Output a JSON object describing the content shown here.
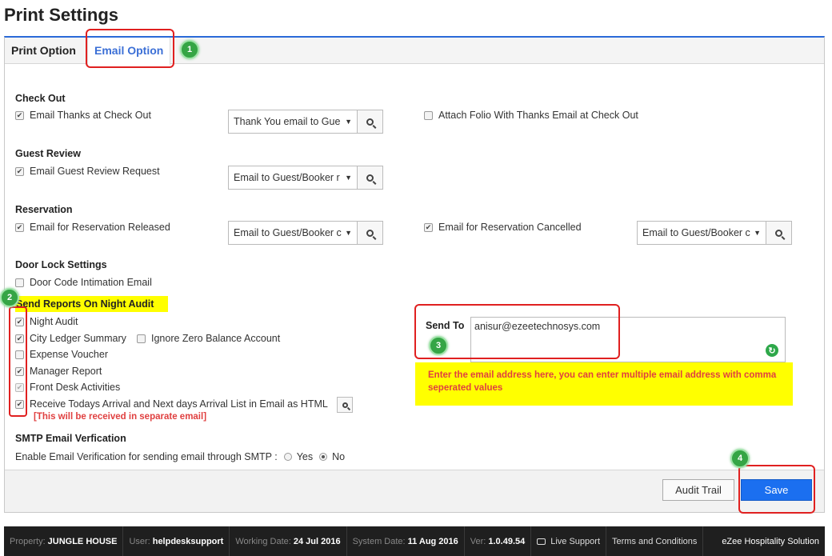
{
  "page_title": "Print Settings",
  "tabs": [
    {
      "label": "Print Option"
    },
    {
      "label": "Email Option"
    }
  ],
  "checkout": {
    "title": "Check Out",
    "thanks_label": "Email Thanks at Check Out",
    "thanks_checked": true,
    "thanks_select": "Thank You email to Gue",
    "attach_label": "Attach Folio With Thanks Email at Check Out",
    "attach_checked": false
  },
  "review": {
    "title": "Guest Review",
    "label": "Email Guest Review Request",
    "checked": true,
    "select": "Email to Guest/Booker r"
  },
  "reservation": {
    "title": "Reservation",
    "released_label": "Email for Reservation Released",
    "released_select": "Email to Guest/Booker c",
    "cancelled_label": "Email for Reservation Cancelled",
    "cancelled_select": "Email to Guest/Booker c"
  },
  "doorlock": {
    "title": "Door Lock Settings",
    "label": "Door Code Intimation Email"
  },
  "night_audit": {
    "title": "Send Reports On Night Audit",
    "items": [
      {
        "label": "Night Audit",
        "checked": true
      },
      {
        "label": "City Ledger Summary",
        "checked": true
      },
      {
        "label": "Expense Voucher",
        "checked": false
      },
      {
        "label": "Manager Report",
        "checked": true
      },
      {
        "label": "Front Desk Activities",
        "checked": true
      },
      {
        "label": "Receive Todays Arrival and Next days Arrival List in Email as HTML",
        "checked": true
      }
    ],
    "ignore_zero_label": "Ignore Zero Balance Account",
    "separate_note": "[This will be received in separate email]"
  },
  "send_to": {
    "label": "Send To",
    "value": "anisur@ezeetechnosys.com",
    "hint": "Enter the email address here, you can enter multiple email address with comma seperated values"
  },
  "smtp": {
    "title": "SMTP Email Verfication",
    "question": "Enable Email Verification for sending email through SMTP :",
    "yes": "Yes",
    "no": "No",
    "selected": "No"
  },
  "buttons": {
    "audit_trail": "Audit Trail",
    "save": "Save"
  },
  "badges": [
    "1",
    "2",
    "3",
    "4"
  ],
  "statusbar": {
    "property_label": "Property:",
    "property_value": "JUNGLE HOUSE",
    "user_label": "User:",
    "user_value": "helpdesksupport",
    "working_label": "Working Date:",
    "working_value": "24 Jul 2016",
    "system_label": "System Date:",
    "system_value": "11 Aug 2016",
    "ver_label": "Ver:",
    "ver_value": "1.0.49.54",
    "live_support": "Live Support",
    "terms": "Terms and Conditions",
    "brand": "eZee Hospitality Solution"
  },
  "colors": {
    "accent": "#1b6ff0",
    "highlight": "#ffff00",
    "annotation_red": "#e02020",
    "badge_green": "#35a545"
  }
}
